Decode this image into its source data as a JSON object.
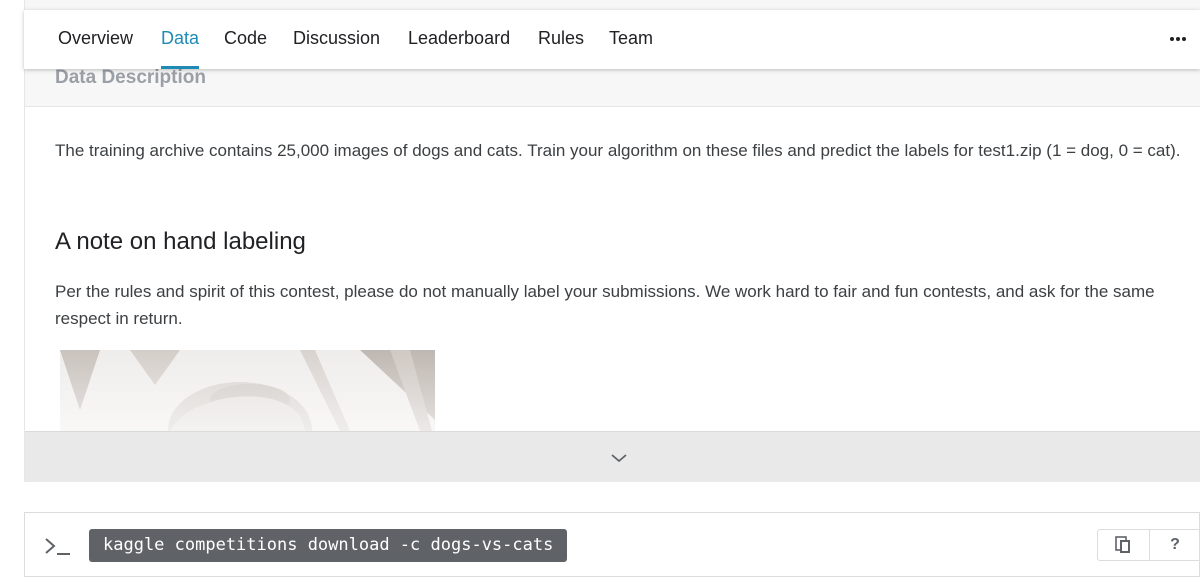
{
  "tabs": [
    {
      "label": "Overview"
    },
    {
      "label": "Data"
    },
    {
      "label": "Code"
    },
    {
      "label": "Discussion"
    },
    {
      "label": "Leaderboard"
    },
    {
      "label": "Rules"
    },
    {
      "label": "Team"
    }
  ],
  "active_tab": "Data",
  "more_icon": "more-horizontal-icon",
  "section": {
    "title": "Data Description",
    "paragraph": "The training archive contains 25,000 images of dogs and cats. Train your algorithm on these files and predict the labels for test1.zip (1 = dog, 0 = cat).",
    "note_heading": "A note on hand labeling",
    "note_paragraph": "Per the rules and spirit of this contest, please do not manually label your submissions. We work hard to fair and fun contests, and ask for the same respect in return."
  },
  "expand_icon": "chevron-down-icon",
  "command": {
    "prompt_icon": "terminal-prompt-icon",
    "text": "kaggle competitions download -c dogs-vs-cats",
    "copy_icon": "copy-icon",
    "help_label": "?"
  },
  "colors": {
    "accent": "#1e8bb6",
    "command_bg": "#5f6368",
    "header_bg": "#f7f7f7"
  }
}
